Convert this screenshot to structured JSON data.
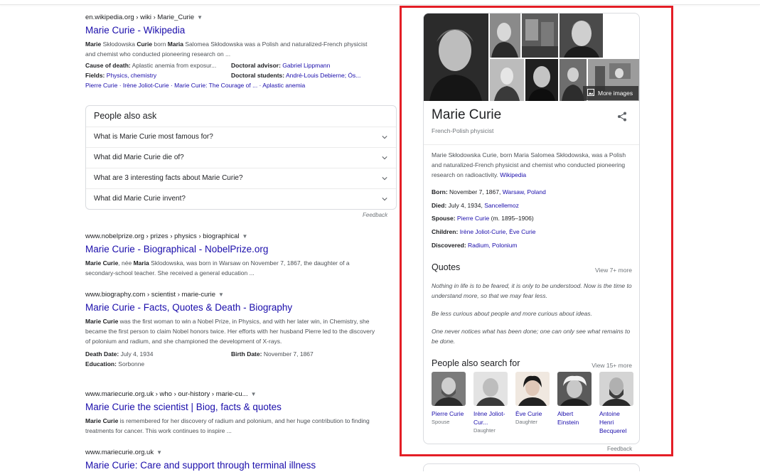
{
  "results": [
    {
      "cite": "en.wikipedia.org › wiki › Marie_Curie",
      "title": "Marie Curie - Wikipedia",
      "snippet_parts": [
        "Marie",
        " Skłodowska ",
        "Curie",
        " born ",
        "Maria",
        " Salomea Skłodowska was a Polish and naturalized-French physicist and chemist who conducted pioneering research on ..."
      ],
      "facts": [
        {
          "label": "Cause of death:",
          "value": "Aplastic anemia from exposur...",
          "label2": "Doctoral advisor:",
          "value2": "Gabriel Lippmann"
        },
        {
          "label": "Fields:",
          "value": "Physics, chemistry",
          "label2": "Doctoral students:",
          "value2": "André-Louis Debierne; Ós..."
        }
      ],
      "sitelinks": "Pierre Curie · Irène Joliot-Curie · Marie Curie: The Courage of ... · Aplastic anemia"
    },
    {
      "cite": "www.nobelprize.org › prizes › physics › biographical",
      "title": "Marie Curie - Biographical - NobelPrize.org",
      "snippet_parts": [
        "Marie Curie",
        ", née ",
        "Maria",
        " Sklodowska, was born in Warsaw on November 7, 1867, the daughter of a secondary-school teacher. She received a general education ..."
      ]
    },
    {
      "cite": "www.biography.com › scientist › marie-curie",
      "title": "Marie Curie - Facts, Quotes & Death - Biography",
      "snippet_parts": [
        "Marie Curie",
        " was the first woman to win a Nobel Prize, in Physics, and with her later win, in Chemistry, she became the first person to claim Nobel honors twice. Her efforts with her husband Pierre led to the discovery of polonium and radium, and she championed the development of X-rays."
      ],
      "facts2": [
        {
          "label": "Death Date:",
          "value": "July 4, 1934",
          "label2": "Birth Date:",
          "value2": "November 7, 1867"
        },
        {
          "label": "Education:",
          "value": "Sorbonne"
        }
      ]
    },
    {
      "cite": "www.mariecurie.org.uk › who › our-history › marie-cu...",
      "title": "Marie Curie the scientist | Biog, facts & quotes",
      "snippet_parts": [
        "Marie Curie",
        " is remembered for her discovery of radium and polonium, and her huge contribution to finding treatments for cancer. This work continues to inspire ..."
      ]
    },
    {
      "cite": "www.mariecurie.org.uk",
      "title": "Marie Curie: Care and support through terminal illness"
    }
  ],
  "paa": {
    "title": "People also ask",
    "questions": [
      "What is Marie Curie most famous for?",
      "What did Marie Curie die of?",
      "What are 3 interesting facts about Marie Curie?",
      "What did Marie Curie invent?"
    ],
    "feedback": "Feedback"
  },
  "kp": {
    "more_images": "More images",
    "name": "Marie Curie",
    "subtitle": "French-Polish physicist",
    "description": "Marie Skłodowska Curie, born Maria Salomea Skłodowska, was a Polish and naturalized-French physicist and chemist who conducted pioneering research on radioactivity.",
    "wiki_link": "Wikipedia",
    "facts": [
      {
        "label": "Born:",
        "text": "November 7, 1867,",
        "links": "Warsaw, Poland"
      },
      {
        "label": "Died:",
        "text": "July 4, 1934,",
        "links": "Sancellemoz"
      },
      {
        "label": "Spouse:",
        "text": "(m. 1895–1906)",
        "links": "Pierre Curie"
      },
      {
        "label": "Children:",
        "text": "",
        "links": "Irène Joliot-Curie, Ève Curie"
      },
      {
        "label": "Discovered:",
        "text": "",
        "links": "Radium, Polonium"
      }
    ],
    "quotes_title": "Quotes",
    "quotes_more": "View 7+ more",
    "quotes": [
      "Nothing in life is to be feared, it is only to be understood. Now is the time to understand more, so that we may fear less.",
      "Be less curious about people and more curious about ideas.",
      "One never notices what has been done; one can only see what remains to be done."
    ],
    "pasf_title": "People also search for",
    "pasf_more": "View 15+ more",
    "pasf": [
      {
        "name": "Pierre Curie",
        "rel": "Spouse"
      },
      {
        "name": "Irène Joliot-Cur...",
        "rel": "Daughter"
      },
      {
        "name": "Ève Curie",
        "rel": "Daughter"
      },
      {
        "name": "Albert Einstein",
        "rel": ""
      },
      {
        "name": "Antoine Henri Becquerel",
        "rel": ""
      }
    ],
    "feedback": "Feedback"
  }
}
